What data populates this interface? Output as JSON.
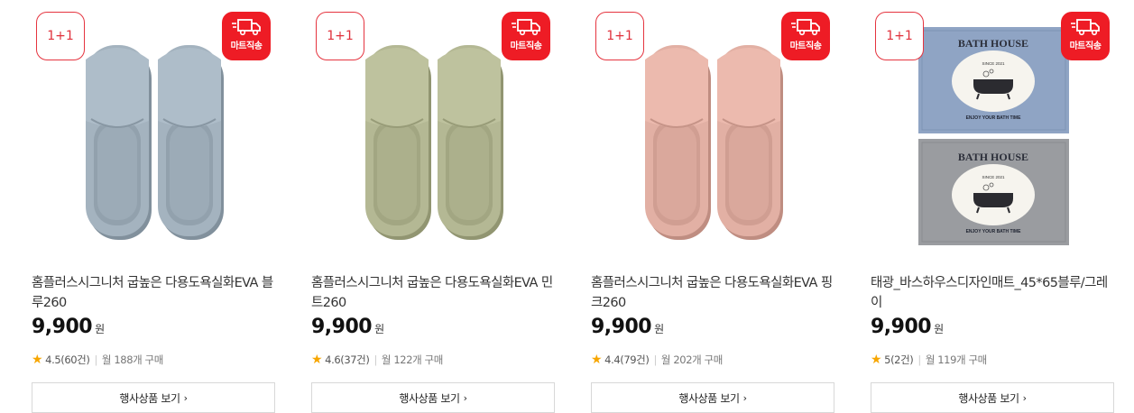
{
  "products": [
    {
      "name": "홈플러스시그니처 굽높은 다용도욕실화EVA 블루260",
      "price": "9,900",
      "unit": "원",
      "rating": "4.5(60건)",
      "sales": "월 188개 구매",
      "promo_badge": "1+1",
      "ship_badge": "마트직송",
      "button": "행사상품 보기",
      "color": "#a4b3bf",
      "image_icon": "slipper-image"
    },
    {
      "name": "홈플러스시그니처 굽높은 다용도욕실화EVA 민트260",
      "price": "9,900",
      "unit": "원",
      "rating": "4.6(37건)",
      "sales": "월 122개 구매",
      "promo_badge": "1+1",
      "ship_badge": "마트직송",
      "button": "행사상품 보기",
      "color": "#b4b894",
      "image_icon": "slipper-image"
    },
    {
      "name": "홈플러스시그니처 굽높은 다용도욕실화EVA 핑크260",
      "price": "9,900",
      "unit": "원",
      "rating": "4.4(79건)",
      "sales": "월 202개 구매",
      "promo_badge": "1+1",
      "ship_badge": "마트직송",
      "button": "행사상품 보기",
      "color": "#e2b0a4",
      "image_icon": "slipper-image"
    },
    {
      "name": "태광_바스하우스디자인매트_45*65블루/그레이",
      "price": "9,900",
      "unit": "원",
      "rating": "5(2건)",
      "sales": "월 119개 구매",
      "promo_badge": "1+1",
      "ship_badge": "마트직송",
      "button": "행사상품 보기",
      "color": "#8fa4c4",
      "image_icon": "bath-mat-image"
    }
  ],
  "mat": {
    "brand": "BATH HOUSE",
    "since": "SINCE 2021",
    "slogan": "ENJOY YOUR BATH TIME",
    "top_color": "#8fa4c4",
    "bottom_color": "#9a9ca0"
  },
  "icons": {
    "rating_star": "star-icon",
    "shipping": "truck-icon",
    "button_arrow": "chevron-right-icon"
  },
  "colors": {
    "badge_red": "#ee1c25",
    "star": "#f7a600"
  },
  "glyphs": {
    "star": "★",
    "sep": "|",
    "chevron": "›"
  }
}
